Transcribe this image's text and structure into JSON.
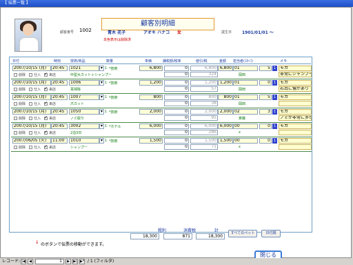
{
  "window": {
    "title": "【 伝票一覧 】"
  },
  "header": {
    "doc_title": "顧客別明細",
    "member_no_label": "顧客番号",
    "member_no": "1002",
    "name": "青木 花子",
    "kana": "アオキ ハナコ",
    "gender": "女",
    "birth_label": "誕生日",
    "birth": "1901/01/01 ～",
    "warning": "本色表示は削除済"
  },
  "columns": [
    "日付",
    "時刻",
    "技術/商品",
    "数量",
    "単価",
    "課税額/税率",
    "値引/税",
    "金額",
    "担当者(ｽﾀｯﾌ)",
    "メモ"
  ],
  "chk_labels": {
    "deleted": "削除",
    "stock": "仕入",
    "done": "来店"
  },
  "records": [
    {
      "date": "2007/10/15 (月)",
      "time": "20:45",
      "code": "1021",
      "item": "中型大カット＋シャンプー",
      "qty": "1",
      "tag": "*技術",
      "price": "6,800",
      "disc": "0",
      "base": "6,800",
      "tax": "324",
      "amount": "6,800",
      "staff_code": "01",
      "staff": "岡田",
      "count": "5",
      "memo1": "モカ",
      "memo2": "非常にシャンプー"
    },
    {
      "date": "2007/10/15 (月)",
      "time": "20:45",
      "code": "1006",
      "item": "耳掃除",
      "qty": "1",
      "tag": "*技術",
      "price": "1,200",
      "disc": "0",
      "base": "1,200",
      "tax": "57",
      "amount": "1,200",
      "staff_code": "01",
      "staff": "岡田",
      "count": "0",
      "memo1": "モカ",
      "memo2": "右耳に傷があり"
    },
    {
      "date": "2007/10/15 (月)",
      "time": "20:45",
      "code": "1007",
      "item": "爪カット",
      "qty": "1",
      "tag": "*技術",
      "price": "800",
      "disc": "0",
      "base": "800",
      "tax": "38",
      "amount": "800",
      "staff_code": "01",
      "staff": "岡田",
      "count": "5",
      "memo1": "モカ",
      "memo2": ""
    },
    {
      "date": "2007/10/15 (月)",
      "time": "20:45",
      "code": "1050",
      "item": "ノミ取り",
      "qty": "1",
      "tag": "*技術",
      "price": "2,000",
      "disc": "0",
      "base": "2,000",
      "tax": "95",
      "amount": "2,000",
      "staff_code": "02",
      "staff": "斉藤",
      "count": "3",
      "memo1": "モカ",
      "memo2": "ノミが非常に多か"
    },
    {
      "date": "2007/10/15 (月)",
      "time": "20:45",
      "code": "3002",
      "item": "2泊3日",
      "qty": "1",
      "tag": "*ホテル",
      "price": "6,000",
      "disc": "0",
      "base": "6,000",
      "tax": "286",
      "amount": "6,000",
      "staff_code": "00",
      "staff": "x",
      "count": "0",
      "memo1": "モカ",
      "memo2": ""
    },
    {
      "date": "2007/06/05 (火)",
      "time": "11:00",
      "code": "1010",
      "item": "シャンプー",
      "qty": "1",
      "tag": "*技術",
      "price": "1,500",
      "disc": "0",
      "base": "1,500",
      "tax": "71",
      "amount": "1,500",
      "staff_code": "00",
      "staff": "x",
      "count": "0",
      "memo1": "モカ",
      "memo2": ""
    }
  ],
  "totals": {
    "subtotal_label": "粗利",
    "subtotal": "18,300",
    "tax_label": "消費税",
    "tax": "871",
    "total_label": "計",
    "total": "18,300"
  },
  "buttons": {
    "all_pets": "すべてのペット",
    "slip": "日付順",
    "close": "閉じる"
  },
  "footer_note": "のボタンで伝票の移動ができます。",
  "statusbar": {
    "record_label": "レコード:",
    "current": "1",
    "of": "/ 1 (フィルタ)"
  }
}
